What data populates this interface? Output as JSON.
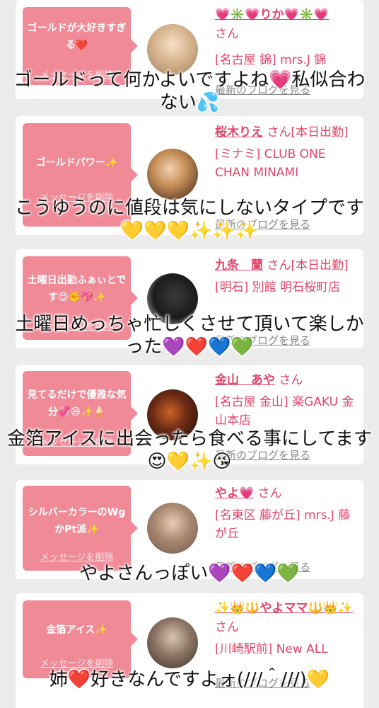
{
  "delete_label": "メッセージを削除",
  "blog_label": "最新のブログを見る",
  "san": "さん",
  "entries": [
    {
      "message": "ゴールドが大好きすぎる❤️",
      "name": "💗✳️💗りか💗✳️💗",
      "status": "",
      "shop": "[名古屋 錦] mrs.J 錦",
      "caption": "ゴールドって何かよいですよね💗私似合わない💦"
    },
    {
      "message": "ゴールドパワー✨",
      "name": "桜木りえ",
      "status": "[本日出勤]",
      "shop": "[ミナミ] CLUB ONE CHAN MINAMI",
      "caption": "こうゆうのに値段は気にしないタイプです💛💛💛✨✨✨"
    },
    {
      "message": "土曜日出勤ふぁぃとです😍✊💖✨",
      "name": "九条　蘭",
      "status": "[本日出勤]",
      "shop": "[明石] 別館 明石桜町店",
      "caption": "土曜日めっちゃ忙しくさせて頂いて楽しかった💜❤️💙💚"
    },
    {
      "message": "見てるだけで優雅な気分💞😆✨🍦",
      "name": "金山　あや",
      "status": "",
      "shop": "[名古屋 金山] 楽GAKU 金山本店",
      "caption": "金箔アイスに出会ったら食べる事にしてます😍💛✨😘"
    },
    {
      "message": "シルバーカラーのWgかPt派✨",
      "name": "やよ💗",
      "status": "",
      "shop": "[名東区 藤が丘] mrs.J 藤が丘",
      "caption": "やよさんっぽい💜❤️💙💚"
    },
    {
      "message": "金箔アイス✨",
      "name": "✨👑🔱やよママ🔱👑✨",
      "status": "",
      "shop": "[川崎駅前] New ALL",
      "caption": "姉❤️好きなんですよォ(///＾///)💛"
    }
  ]
}
